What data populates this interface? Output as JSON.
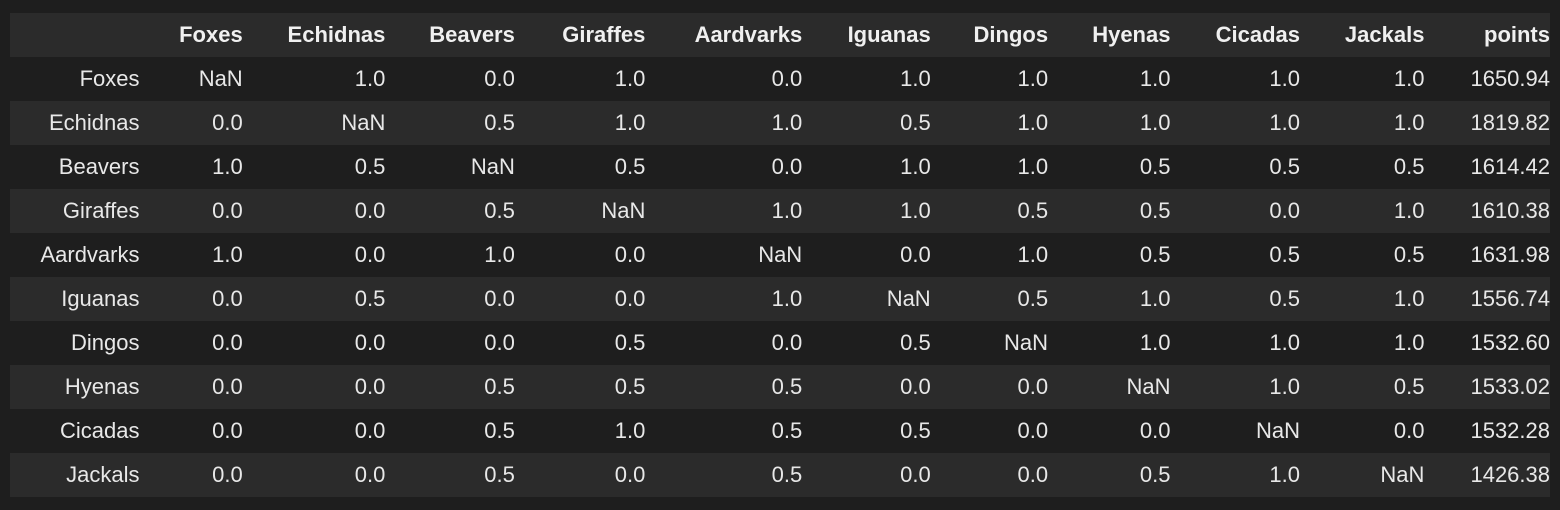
{
  "table": {
    "columns": [
      "",
      "Foxes",
      "Echidnas",
      "Beavers",
      "Giraffes",
      "Aardvarks",
      "Iguanas",
      "Dingos",
      "Hyenas",
      "Cicadas",
      "Jackals",
      "points"
    ],
    "rows": [
      {
        "label": "Foxes",
        "cells": [
          "NaN",
          "1.0",
          "0.0",
          "1.0",
          "0.0",
          "1.0",
          "1.0",
          "1.0",
          "1.0",
          "1.0",
          "1650.94"
        ]
      },
      {
        "label": "Echidnas",
        "cells": [
          "0.0",
          "NaN",
          "0.5",
          "1.0",
          "1.0",
          "0.5",
          "1.0",
          "1.0",
          "1.0",
          "1.0",
          "1819.82"
        ]
      },
      {
        "label": "Beavers",
        "cells": [
          "1.0",
          "0.5",
          "NaN",
          "0.5",
          "0.0",
          "1.0",
          "1.0",
          "0.5",
          "0.5",
          "0.5",
          "1614.42"
        ]
      },
      {
        "label": "Giraffes",
        "cells": [
          "0.0",
          "0.0",
          "0.5",
          "NaN",
          "1.0",
          "1.0",
          "0.5",
          "0.5",
          "0.0",
          "1.0",
          "1610.38"
        ]
      },
      {
        "label": "Aardvarks",
        "cells": [
          "1.0",
          "0.0",
          "1.0",
          "0.0",
          "NaN",
          "0.0",
          "1.0",
          "0.5",
          "0.5",
          "0.5",
          "1631.98"
        ]
      },
      {
        "label": "Iguanas",
        "cells": [
          "0.0",
          "0.5",
          "0.0",
          "0.0",
          "1.0",
          "NaN",
          "0.5",
          "1.0",
          "0.5",
          "1.0",
          "1556.74"
        ]
      },
      {
        "label": "Dingos",
        "cells": [
          "0.0",
          "0.0",
          "0.0",
          "0.5",
          "0.0",
          "0.5",
          "NaN",
          "1.0",
          "1.0",
          "1.0",
          "1532.60"
        ]
      },
      {
        "label": "Hyenas",
        "cells": [
          "0.0",
          "0.0",
          "0.5",
          "0.5",
          "0.5",
          "0.0",
          "0.0",
          "NaN",
          "1.0",
          "0.5",
          "1533.02"
        ]
      },
      {
        "label": "Cicadas",
        "cells": [
          "0.0",
          "0.0",
          "0.5",
          "1.0",
          "0.5",
          "0.5",
          "0.0",
          "0.0",
          "NaN",
          "0.0",
          "1532.28"
        ]
      },
      {
        "label": "Jackals",
        "cells": [
          "0.0",
          "0.0",
          "0.5",
          "0.0",
          "0.5",
          "0.0",
          "0.0",
          "0.5",
          "1.0",
          "NaN",
          "1426.38"
        ]
      }
    ]
  },
  "colors": {
    "background": "#1e1e1e",
    "stripe": "#2b2b2b",
    "text": "#e8e8e8"
  }
}
